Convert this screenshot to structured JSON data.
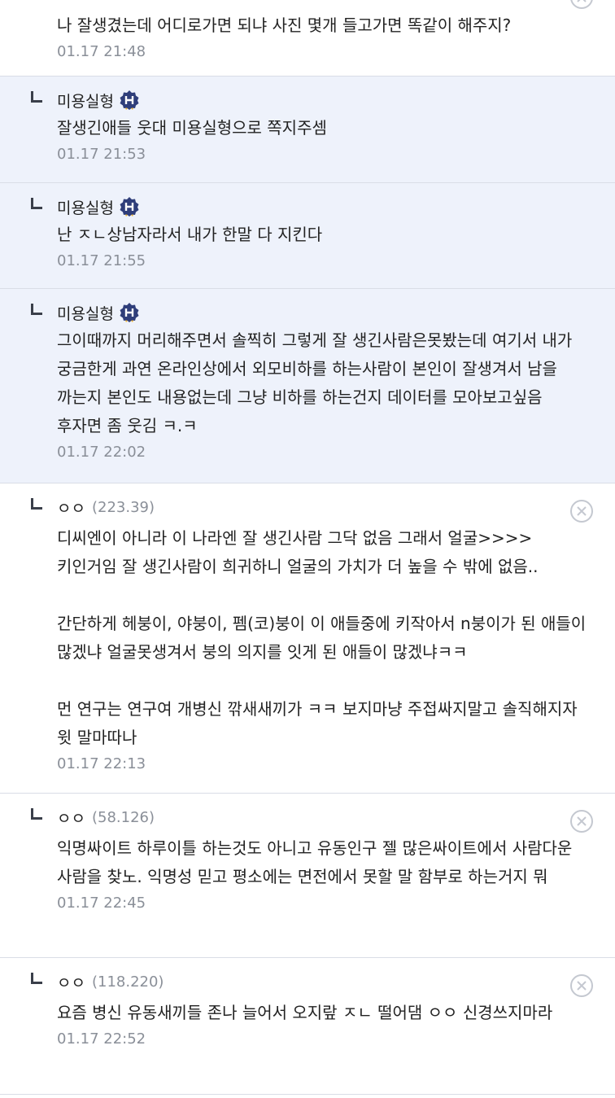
{
  "comments": [
    {
      "body": "나 잘생겼는데 어디로가면 되냐 사진 몇개 들고가면 똑같이 해주지?",
      "date": "01.17 21:48"
    },
    {
      "nick": "미용실형",
      "body": "잘생긴애들 웃대 미용실형으로 쪽지주셈",
      "date": "01.17 21:53"
    },
    {
      "nick": "미용실형",
      "body": "난 ㅈㄴ상남자라서 내가 한말 다 지킨다",
      "date": "01.17 21:55"
    },
    {
      "nick": "미용실형",
      "body": "그이때까지 머리해주면서 솔찍히 그렇게 잘 생긴사람은못봤는데 여기서 내가 궁금한게 과연 온라인상에서 외모비하를 하는사람이 본인이 잘생겨서 남을 까는지 본인도 내용없는데 그냥 비하를 하는건지 데이터를 모아보고싶음 후자면 좀 웃김 ㅋ.ㅋ",
      "date": "01.17 22:02"
    },
    {
      "nick": "ㅇㅇ",
      "ip": "(223.39)",
      "body": "디씨엔이 아니라 이 나라엔 잘 생긴사람 그닥 없음 그래서 얼굴>>>>키인거임 잘 생긴사람이 희귀하니 얼굴의 가치가 더 높을 수 밖에 없음..\n\n간단하게 헤붕이, 야붕이, 펨(코)붕이 이 애들중에 키작아서 n붕이가 된 애들이 많겠냐 얼굴못생겨서 붕의 의지를 잇게 된 애들이 많겠냐ㅋㅋ\n\n먼 연구는 연구여 개병신 깎새새끼가 ㅋㅋ 보지마냥 주접싸지말고 솔직해지자 윗 말마따나",
      "date": "01.17 22:13"
    },
    {
      "nick": "ㅇㅇ",
      "ip": "(58.126)",
      "body": "익명싸이트 하루이틀 하는것도 아니고 유동인구 젤 많은싸이트에서 사람다운 사람을 찾노. 익명성 믿고 평소에는 면전에서 못할 말 함부로 하는거지 뭐",
      "date": "01.17 22:45"
    },
    {
      "nick": "ㅇㅇ",
      "ip": "(118.220)",
      "body": "요즘 병신 유동새끼들 존나 늘어서 오지랖 ㅈㄴ 떨어댐 ㅇㅇ 신경쓰지마라",
      "date": "01.17 22:52"
    }
  ],
  "colors": {
    "author_bg": "#eef2fb",
    "badge": "#2f3e7a",
    "badge_ribbon": "#f0b431",
    "meta": "#8a8f98"
  },
  "icons": {
    "reply_arrow": "reply-arrow-icon",
    "author_badge": "author-badge-icon",
    "delete": "delete-circle-x-icon"
  }
}
